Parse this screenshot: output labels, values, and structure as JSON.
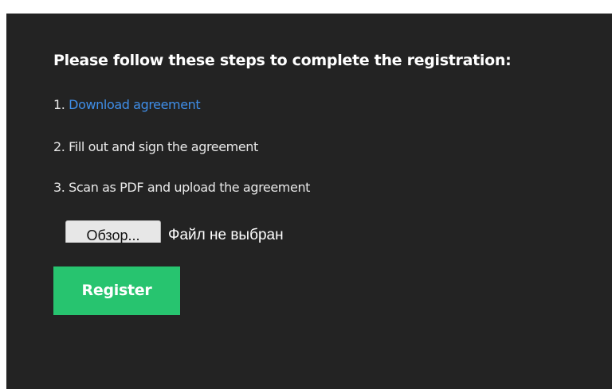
{
  "registration": {
    "heading": "Please follow these steps to complete the registration:",
    "steps": [
      {
        "number": "1.",
        "link_text": "Download agreement"
      },
      {
        "number": "2.",
        "text": "Fill out and sign the agreement"
      },
      {
        "number": "3.",
        "text": "Scan as PDF and upload the agreement"
      }
    ],
    "file_input": {
      "button_label": "Обзор...",
      "status": "Файл не выбран"
    },
    "register_label": "Register"
  },
  "colors": {
    "panel_background": "#232323",
    "link": "#3f8ee8",
    "register_button": "#27c46f",
    "text": "#ffffff"
  }
}
